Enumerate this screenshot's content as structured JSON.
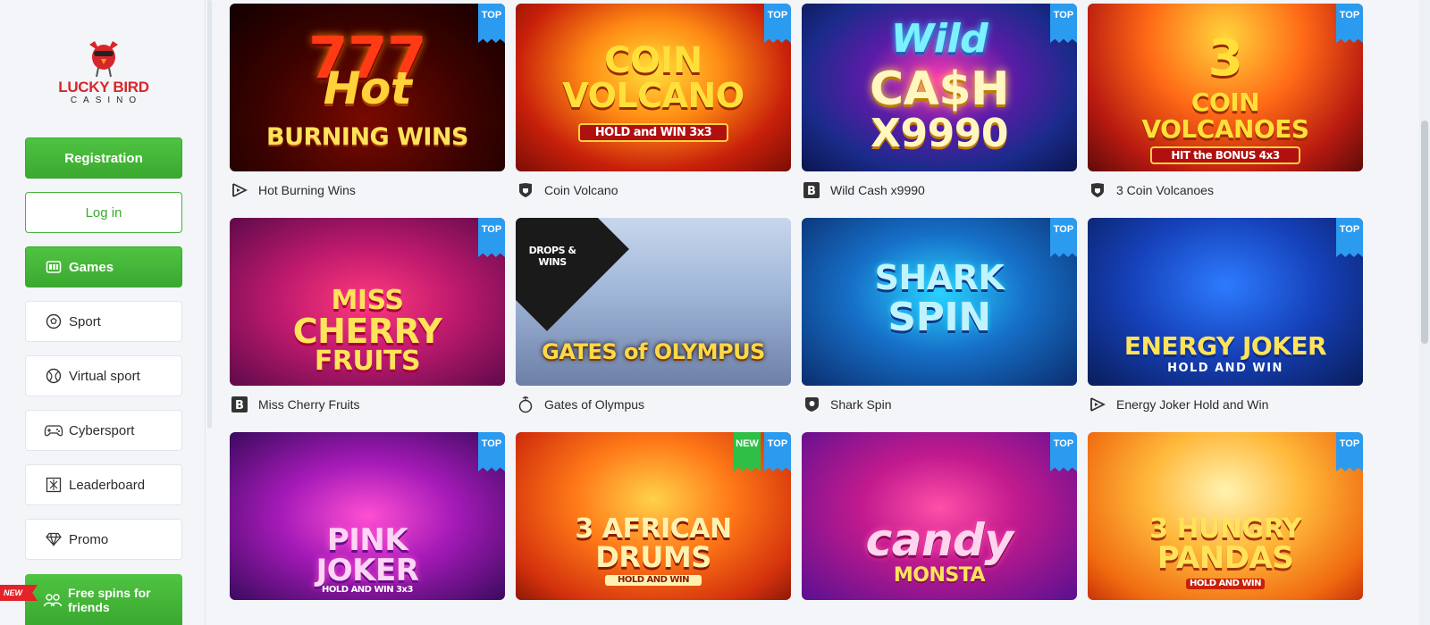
{
  "brand": {
    "name": "LUCKY BIRD",
    "sub": "CASINO"
  },
  "sidebar": {
    "registration_label": "Registration",
    "login_label": "Log in",
    "items": [
      {
        "label": "Games",
        "icon": "games-icon",
        "active": true
      },
      {
        "label": "Sport",
        "icon": "soccer-ball-icon"
      },
      {
        "label": "Virtual sport",
        "icon": "tennis-ball-icon"
      },
      {
        "label": "Cybersport",
        "icon": "gamepad-icon"
      },
      {
        "label": "Leaderboard",
        "icon": "leaderboard-icon"
      },
      {
        "label": "Promo",
        "icon": "diamond-icon"
      }
    ],
    "free_spins_label": "Free spins for friends",
    "new_flag": "NEW"
  },
  "badges": {
    "top": "TOP",
    "new": "NEW"
  },
  "games": [
    {
      "name": "Hot Burning Wins",
      "art_line1": "777",
      "art_line2": "Hot",
      "art_line3": "BURNING WINS",
      "provider_icon": "play-provider-icon",
      "badges": [
        "TOP"
      ]
    },
    {
      "name": "Coin Volcano",
      "art_line1": "COIN",
      "art_line2": "VOLCANO",
      "art_line3": "HOLD and WIN 3x3",
      "provider_icon": "shield-provider-icon",
      "badges": [
        "TOP"
      ]
    },
    {
      "name": "Wild Cash x9990",
      "art_line1": "Wild",
      "art_line2": "CA$H",
      "art_line3": "X9990",
      "provider_icon": "b-provider-icon",
      "badges": [
        "TOP"
      ]
    },
    {
      "name": "3 Coin Volcanoes",
      "art_line1": "3",
      "art_line2": "COIN VOLCANOES",
      "art_line3": "HIT the BONUS 4x3",
      "provider_icon": "shield-provider-icon",
      "badges": [
        "TOP"
      ]
    },
    {
      "name": "Miss Cherry Fruits",
      "art_line1": "MISS",
      "art_line2": "CHERRY",
      "art_line3": "FRUITS",
      "provider_icon": "b-provider-icon",
      "badges": [
        "TOP"
      ]
    },
    {
      "name": "Gates of Olympus",
      "art_line1": "DROPS & WINS",
      "art_line2": "GATES of OLYMPUS",
      "art_line3": "",
      "provider_icon": "pragmatic-provider-icon",
      "badges": []
    },
    {
      "name": "Shark Spin",
      "art_line1": "SHARK",
      "art_line2": "SPIN",
      "art_line3": "",
      "provider_icon": "location-provider-icon",
      "badges": [
        "TOP"
      ]
    },
    {
      "name": "Energy Joker Hold and Win",
      "art_line1": "ENERGY JOKER",
      "art_line2": "HOLD AND WIN",
      "art_line3": "",
      "provider_icon": "play-provider-icon",
      "badges": [
        "TOP"
      ]
    },
    {
      "name": "",
      "art_line1": "PINK",
      "art_line2": "JOKER",
      "art_line3": "HOLD AND WIN 3x3",
      "provider_icon": "",
      "badges": [
        "TOP"
      ]
    },
    {
      "name": "",
      "art_line1": "3 AFRICAN",
      "art_line2": "DRUMS",
      "art_line3": "HOLD AND WIN",
      "provider_icon": "",
      "badges": [
        "NEW",
        "TOP"
      ]
    },
    {
      "name": "",
      "art_line1": "candy",
      "art_line2": "MONSTA",
      "art_line3": "",
      "provider_icon": "",
      "badges": [
        "TOP"
      ]
    },
    {
      "name": "",
      "art_line1": "3 HUNGRY",
      "art_line2": "PANDAS",
      "art_line3": "HOLD AND WIN",
      "provider_icon": "",
      "badges": [
        "TOP"
      ]
    }
  ],
  "colors": {
    "green": "#3aa92f",
    "top_badge": "#2b9bf0",
    "new_badge": "#2fbf46",
    "brand_red": "#d7262a"
  }
}
